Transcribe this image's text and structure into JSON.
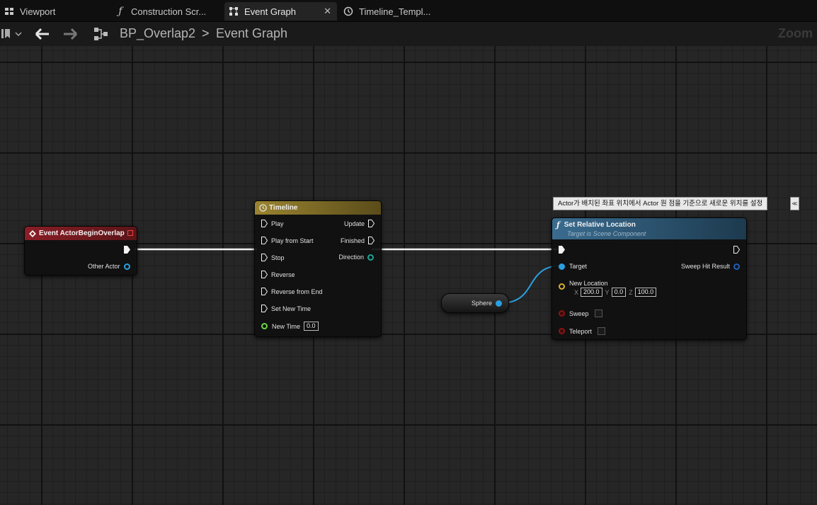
{
  "tabs": [
    {
      "label": "Viewport",
      "icon": "viewport-grid-icon"
    },
    {
      "label": "Construction Scr...",
      "icon": "function-icon"
    },
    {
      "label": "Event Graph",
      "icon": "graph-icon",
      "active": true
    },
    {
      "label": "Timeline_Templ...",
      "icon": "clock-icon"
    }
  ],
  "tab_close": "✕",
  "breadcrumb": {
    "blueprint": "BP_Overlap2",
    "separator": ">",
    "graph": "Event Graph"
  },
  "zoom_label": "Zoom",
  "nodes": {
    "event": {
      "title": "Event ActorBeginOverlap",
      "pin_other_actor": "Other Actor",
      "color": "#7a1f25"
    },
    "timeline": {
      "title": "Timeline",
      "color": "#8a7424",
      "inputs": [
        "Play",
        "Play from Start",
        "Stop",
        "Reverse",
        "Reverse from End",
        "Set New Time"
      ],
      "new_time_label": "New Time",
      "new_time_value": "0.0",
      "outputs": [
        "Update",
        "Finished",
        "Direction"
      ]
    },
    "sphere": {
      "label": "Sphere"
    },
    "set_location": {
      "title": "Set Relative Location",
      "subtitle": "Target is Scene Component",
      "color": "#2e5878",
      "tooltip": "Actor가 배치된 좌표 위치에서 Actor 원 점을 기준으로 새로운 위치를 설정",
      "target_label": "Target",
      "new_location_label": "New Location",
      "x_label": "X",
      "x_value": "200.0",
      "y_label": "Y",
      "y_value": "0.0",
      "z_label": "Z",
      "z_value": "100.0",
      "sweep_label": "Sweep",
      "teleport_label": "Teleport",
      "sweep_hit_result_label": "Sweep Hit Result"
    }
  }
}
